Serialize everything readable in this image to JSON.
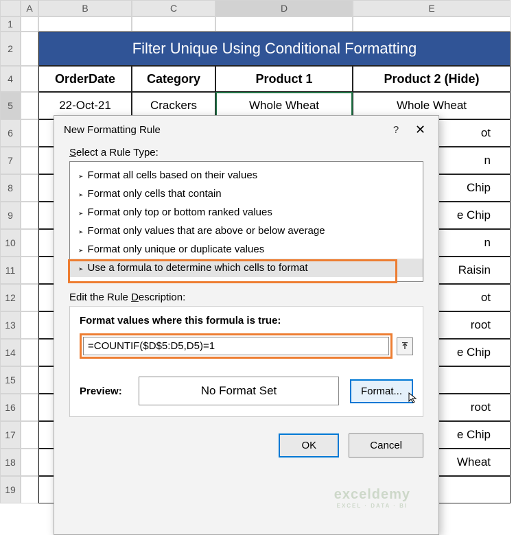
{
  "columns": [
    "A",
    "B",
    "C",
    "D",
    "E"
  ],
  "rows": [
    "1",
    "2",
    "4",
    "5",
    "6",
    "7",
    "8",
    "9",
    "10",
    "11",
    "12",
    "13",
    "14",
    "15",
    "16",
    "17",
    "18",
    "19"
  ],
  "title": "Filter Unique Using Conditional Formatting",
  "headers": {
    "b": "OrderDate",
    "c": "Category",
    "d": "Product 1",
    "e": "Product 2 (Hide)"
  },
  "row5": {
    "b": "22-Oct-21",
    "c": "Crackers",
    "d": "Whole Wheat",
    "e": "Whole Wheat"
  },
  "colE_partial": [
    "ot",
    "n",
    "Chip",
    "e Chip",
    "n",
    "Raisin",
    "ot",
    "root",
    "e Chip",
    "",
    "root",
    "e Chip",
    "Wheat",
    ""
  ],
  "dialog": {
    "title": "New Formatting Rule",
    "select_label": "Select a Rule Type:",
    "rule_types": [
      "Format all cells based on their values",
      "Format only cells that contain",
      "Format only top or bottom ranked values",
      "Format only values that are above or below average",
      "Format only unique or duplicate values",
      "Use a formula to determine which cells to format"
    ],
    "edit_label": "Edit the Rule Description:",
    "desc_title": "Format values where this formula is true:",
    "formula": "=COUNTIF($D$5:D5,D5)=1",
    "preview_label": "Preview:",
    "preview_text": "No Format Set",
    "format_btn": "Format...",
    "ok": "OK",
    "cancel": "Cancel"
  },
  "watermark": {
    "main": "exceldemy",
    "sub": "EXCEL · DATA · BI"
  }
}
